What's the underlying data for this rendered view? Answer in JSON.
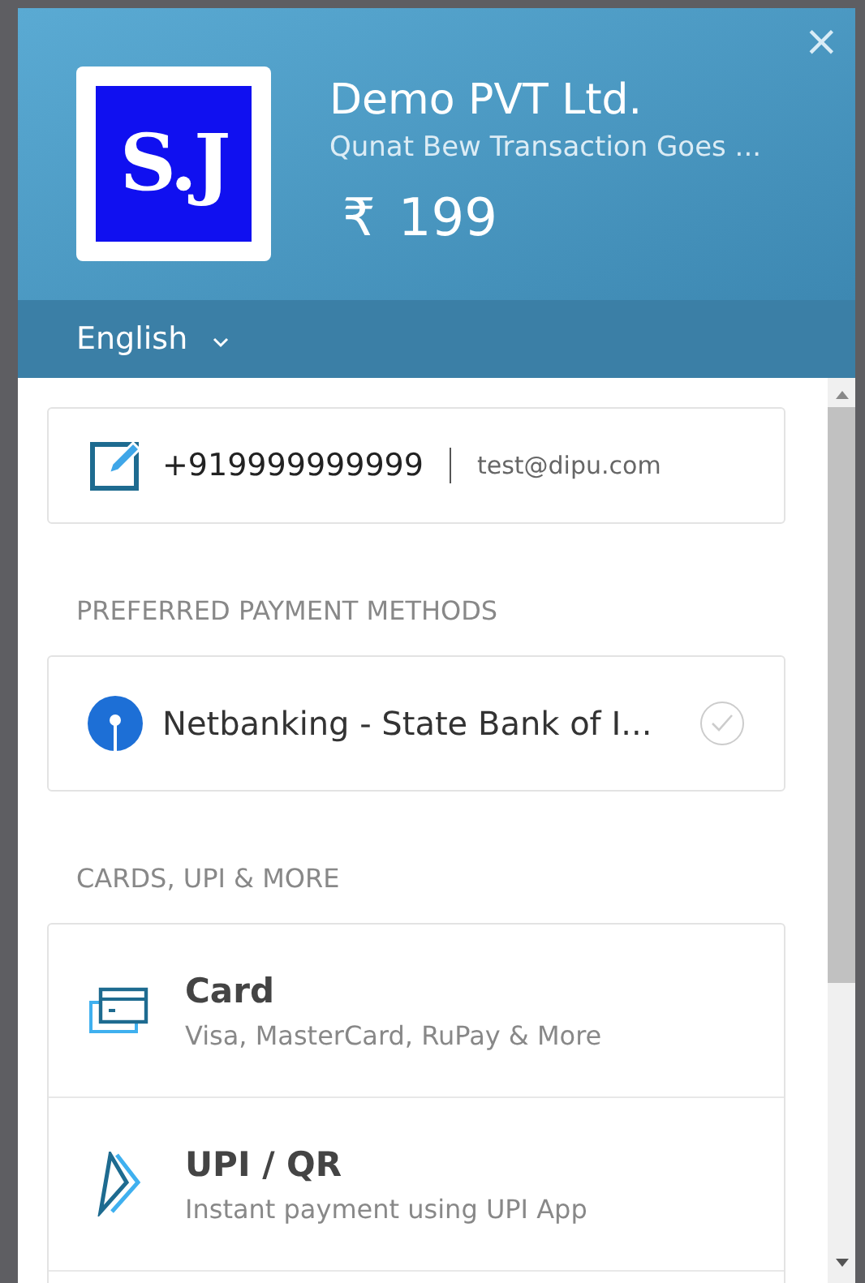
{
  "merchant": {
    "logo_text": "S.J",
    "name": "Demo PVT Ltd.",
    "description": "Qunat Bew Transaction Goes ...",
    "currency": "₹",
    "amount": "199"
  },
  "close": "×",
  "language": {
    "label": "English"
  },
  "contact": {
    "phone": "+919999999999",
    "email": "test@dipu.com"
  },
  "preferred": {
    "heading": "PREFERRED PAYMENT METHODS",
    "items": [
      {
        "label": "Netbanking - State Bank of I...",
        "selected": false
      }
    ]
  },
  "more": {
    "heading": "CARDS, UPI & MORE",
    "items": [
      {
        "kind": "card",
        "title": "Card",
        "subtitle": "Visa, MasterCard, RuPay & More"
      },
      {
        "kind": "upi",
        "title": "UPI / QR",
        "subtitle": "Instant payment using UPI App"
      }
    ]
  }
}
